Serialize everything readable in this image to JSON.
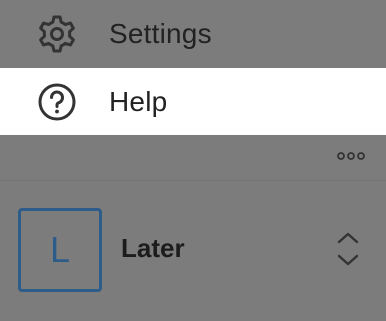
{
  "menu": {
    "items": [
      {
        "label": "Settings",
        "icon": "gear-icon"
      },
      {
        "label": "Help",
        "icon": "question-circle-icon"
      }
    ]
  },
  "more_icon": "more-horizontal-icon",
  "account": {
    "avatar_letter": "L",
    "name": "Later",
    "switcher_icon": "chevron-up-down-icon"
  },
  "colors": {
    "overlay_background": "#7c7c7c",
    "selected_row": "#ffffff",
    "accent": "#2e5c88",
    "icon": "#333333",
    "text": "#222222"
  }
}
